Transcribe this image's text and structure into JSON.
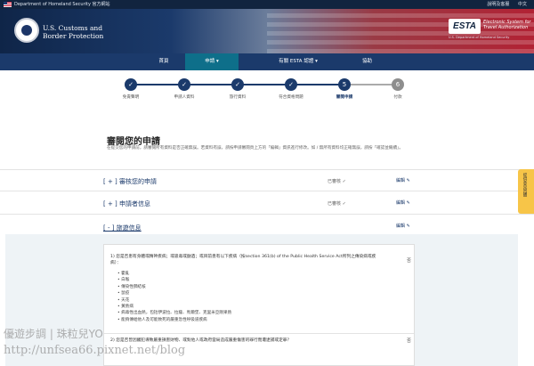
{
  "topbar": {
    "text": "Department of Homeland Security 官方網站",
    "links": [
      "說明及客服",
      "中文"
    ]
  },
  "header": {
    "agency_line1": "U.S. Customs and",
    "agency_line2": "Border Protection",
    "esta_logo": "ESTA",
    "esta_sub_line1": "Electronic System for",
    "esta_sub_line2": "Travel Authorization",
    "esta_dhs": "U.S. Department of Homeland Security"
  },
  "nav": {
    "items": [
      "首頁",
      "申請 ▾",
      "有關 ESTA 認證 ▾",
      "協助"
    ]
  },
  "progress": {
    "steps": [
      {
        "num": "✓",
        "label": "免責聲明"
      },
      {
        "num": "✓",
        "label": "申請人資料"
      },
      {
        "num": "✓",
        "label": "旅行資料"
      },
      {
        "num": "✓",
        "label": "符合資格問題"
      },
      {
        "num": "5",
        "label": "審閱申請"
      },
      {
        "num": "6",
        "label": "付款"
      }
    ]
  },
  "main": {
    "title": "審閱您的申請",
    "intro": "在提交您的申請前，請審閱所有資料是否正確無誤。若資料有誤，請按申請審閱頁上方的「編輯」資訊進行修改。如 / 無所有資料均正確無誤，請按「確認並繼續」。",
    "sections": [
      {
        "label": "[ + ] 審核您的申請",
        "status": "已審核 ✓",
        "edit": "編輯 ✎"
      },
      {
        "label": "[ + ] 申請者信息",
        "status": "已審核 ✓",
        "edit": "編輯 ✎"
      },
      {
        "label": "[ - ] 旅遊信息",
        "edit": "編輯 ✎"
      }
    ]
  },
  "side_tab": "提供意見回饋",
  "card": {
    "q1": "1) 您是否患有身體或精神疾病；或吸毒或酗酒；或目前患有以下疾病（按section 361(b) of the Public Health Service Act所列之傳染病或疾病）：",
    "diseases": [
      "霍亂",
      "白喉",
      "傳染性肺結核",
      "鼠疫",
      "天花",
      "黃熱病",
      "病毒性出血熱，包括伊波拉、拉薩、馬爾堡、克里米亞剛果熱",
      "能夠傳給他人及可能致死的嚴重急性呼吸道疾病"
    ],
    "ans1": "否",
    "q2": "2) 您是否曾因觸犯導致嚴重損害財物、或對他人或政府當局造成嚴重傷害的罪行而遭逮捕或定罪？",
    "ans2": "否"
  },
  "watermark": {
    "line1": "優遊步調 | 珠粒兒YO",
    "line2": "http://unfsea66.pixnet.net/blog"
  },
  "colors": {
    "navy": "#1b3a6b",
    "teal_active": "#0e6f8a",
    "feedback_tab": "#f7c548",
    "todo_step": "#8e8e8e"
  }
}
